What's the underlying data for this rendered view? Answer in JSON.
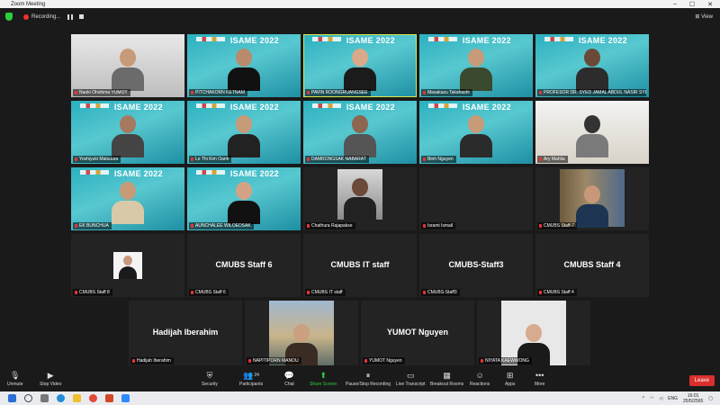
{
  "window": {
    "title": "Zoom Meeting"
  },
  "topbar": {
    "recording_label": "Recording...",
    "view_label": "View"
  },
  "participants": [
    {
      "name": "Naoki Ohshima YUMOT",
      "type": "video"
    },
    {
      "name": "PITCHAKORN KETNAM",
      "type": "video",
      "banner": "ISAME 2022"
    },
    {
      "name": "PAVIN ROONGRUANGSEE",
      "type": "video",
      "banner": "ISAME 2022",
      "active": true
    },
    {
      "name": "Masakazu Takahashi",
      "type": "video",
      "banner": "ISAME 2022"
    },
    {
      "name": "PROFESOR DR. SYED JAMAL ABDUL NASIR SYE...",
      "type": "video",
      "banner": "ISAME 2022"
    },
    {
      "name": "Yoshiyuki Matsuura",
      "type": "video",
      "banner": "ISAME 2022"
    },
    {
      "name": "Le Thi Kim Oanh",
      "type": "video",
      "banner": "ISAME 2022"
    },
    {
      "name": "DAMRONGSAK NABARAT",
      "type": "video",
      "banner": "ISAME 2022"
    },
    {
      "name": "Binh Nguyen",
      "type": "video",
      "banner": "ISAME 2022"
    },
    {
      "name": "Ary Mahlia",
      "type": "video"
    },
    {
      "name": "EK BUNCHUA",
      "type": "video",
      "banner": "ISAME 2022"
    },
    {
      "name": "AUNCHALEE WILOEDSAK",
      "type": "video",
      "banner": "ISAME 2022"
    },
    {
      "name": "Chathura Rajapakse",
      "type": "photo"
    },
    {
      "name": "Isrami Ismail",
      "type": "dark"
    },
    {
      "name": "CMUBS Staff-7",
      "type": "photo"
    },
    {
      "name": "CMUBS Staff 8",
      "type": "photo"
    },
    {
      "name": "CMUBS Staff 6",
      "type": "dark",
      "display": "CMUBS Staff 6"
    },
    {
      "name": "CMUBS IT staff",
      "type": "dark",
      "display": "CMUBS IT staff"
    },
    {
      "name": "CMUBS-Staff3",
      "type": "dark",
      "display": "CMUBS-Staff3"
    },
    {
      "name": "CMUBS Staff 4",
      "type": "dark",
      "display": "CMUBS Staff 4"
    },
    {
      "name": "Hadijah Iberahim",
      "type": "dark",
      "display": "Hadijah Iberahim"
    },
    {
      "name": "NAPITIPORN MANOU",
      "type": "photo"
    },
    {
      "name": "YUMOT Nguyen",
      "type": "dark",
      "display": "YUMOT Nguyen"
    },
    {
      "name": "NIYATA KAEWWONG",
      "type": "photo"
    }
  ],
  "toolbar": {
    "unmute": "Unmute",
    "stop_video": "Stop Video",
    "security": "Security",
    "participants": "Participants",
    "participants_count": "24",
    "chat": "Chat",
    "share_screen": "Share Screen",
    "pause_recording": "Pause/Stop Recording",
    "live_transcript": "Live Transcript",
    "breakout_rooms": "Breakout Rooms",
    "reactions": "Reactions",
    "apps": "Apps",
    "more": "More",
    "leave": "Leave"
  },
  "taskbar": {
    "lang": "ENG",
    "time": "16:01",
    "date": "25/5/2565"
  },
  "colors": {
    "active_border": "#d8e84a",
    "leave": "#d9302e",
    "share": "#2ecc40"
  }
}
